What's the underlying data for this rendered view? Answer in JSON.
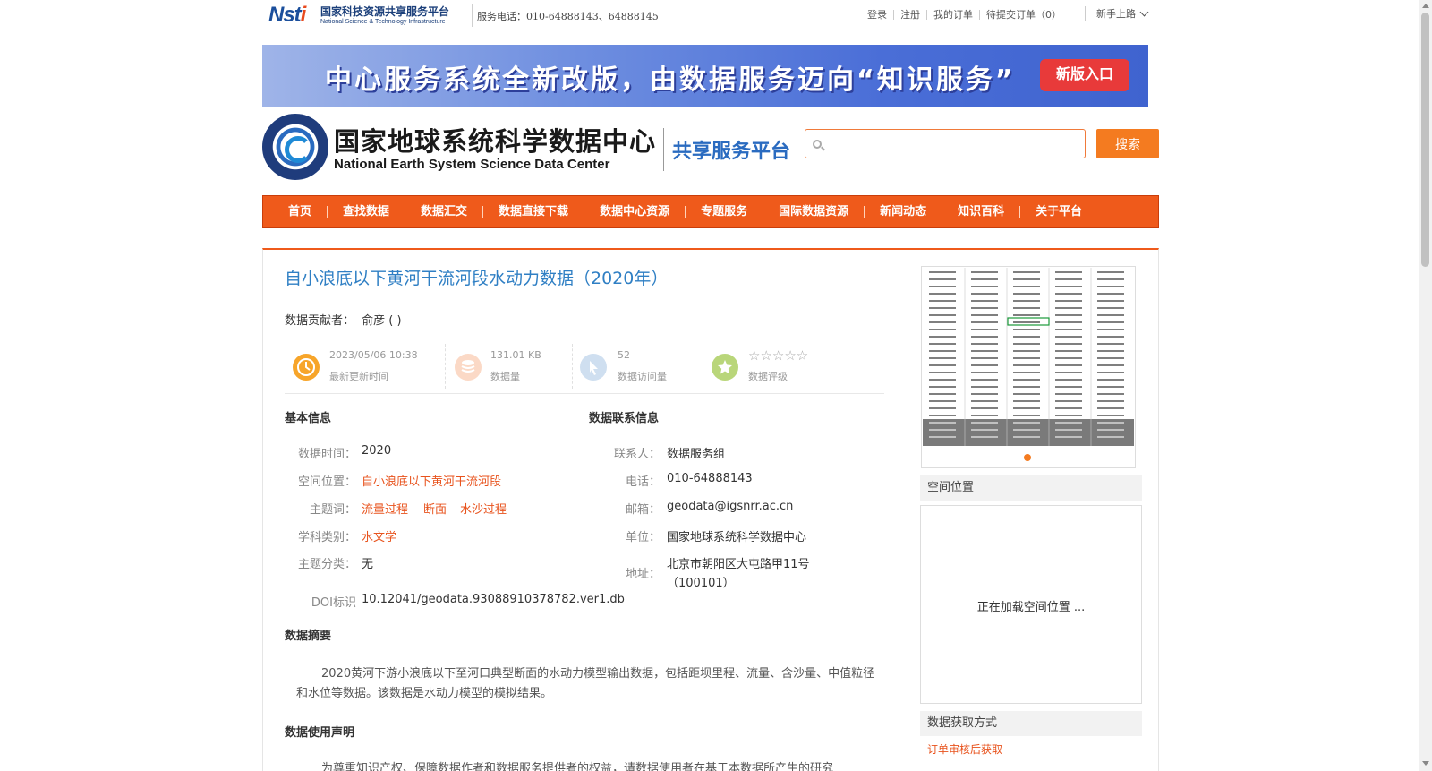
{
  "topbar": {
    "logo_cn": "国家科技资源共享服务平台",
    "logo_en": "National Science & Technology Infrastructure",
    "hotline": "服务电话：010-64888143、64888145",
    "links": [
      "登录",
      "注册",
      "我的订单",
      "待提交订单（0）"
    ],
    "newbie": "新手上路"
  },
  "banner": {
    "text": "中心服务系统全新改版，由数据服务迈向“知识服务”",
    "button": "新版入口"
  },
  "header": {
    "logo_cn": "国家地球系统科学数据中心",
    "logo_en": "National Earth System Science Data Center",
    "platform": "共享服务平台",
    "search_placeholder": "",
    "search_button": "搜索"
  },
  "nav": [
    "首页",
    "查找数据",
    "数据汇交",
    "数据直接下载",
    "数据中心资源",
    "专题服务",
    "国际数据资源",
    "新闻动态",
    "知识百科",
    "关于平台"
  ],
  "dataset": {
    "title": "自小浪底以下黄河干流河段水动力数据（2020年）",
    "contributor_label": "数据贡献者：",
    "contributor": "俞彦 ( )"
  },
  "stats": {
    "updated": {
      "value": "2023/05/06 10:38",
      "label": "最新更新时间"
    },
    "size": {
      "value": "131.01 KB",
      "label": "数据量"
    },
    "visits": {
      "value": "52",
      "label": "数据访问量"
    },
    "rating": {
      "stars": "☆☆☆☆☆",
      "label": "数据评级",
      "score": 0
    }
  },
  "basic_info": {
    "heading": "基本信息",
    "time_label": "数据时间：",
    "time": "2020",
    "location_label": "空间位置：",
    "location": "自小浪底以下黄河干流河段",
    "keywords_label": "主题词：",
    "keywords": [
      "流量过程",
      "断面",
      "水沙过程"
    ],
    "discipline_label": "学科类别：",
    "discipline": "水文学",
    "category_label": "主题分类：",
    "category": "无",
    "doi_label": "DOI标识",
    "doi": "10.12041/geodata.93088910378782.ver1.db"
  },
  "contact": {
    "heading": "数据联系信息",
    "person_label": "联系人：",
    "person": "数据服务组",
    "phone_label": "电话：",
    "phone": "010-64888143",
    "email_label": "邮箱：",
    "email": "geodata@igsnrr.ac.cn",
    "org_label": "单位：",
    "org": "国家地球系统科学数据中心",
    "address_label": "地址：",
    "address_line1": "北京市朝阳区大屯路甲11号",
    "address_line2": "（100101）"
  },
  "abstract": {
    "heading": "数据摘要",
    "text": "2020黄河下游小浪底以下至河口典型断面的水动力模型输出数据，包括距坝里程、流量、含沙量、中值粒径和水位等数据。该数据是水动力模型的模拟结果。"
  },
  "usage": {
    "heading": "数据使用声明",
    "text": "为尊重知识产权、保障数据作者和数据服务提供者的权益，请数据使用者在基于本数据所产生的研究"
  },
  "sidebar": {
    "spatial_heading": "空间位置",
    "map_loading": "正在加载空间位置 ...",
    "acquire_heading": "数据获取方式",
    "acquire_link": "订单审核后获取"
  },
  "colors": {
    "nav_orange": "#ef5a1b",
    "link_orange": "#e8531d",
    "title_blue": "#2f7fc4",
    "banner_blue": "#4a6ed7"
  }
}
